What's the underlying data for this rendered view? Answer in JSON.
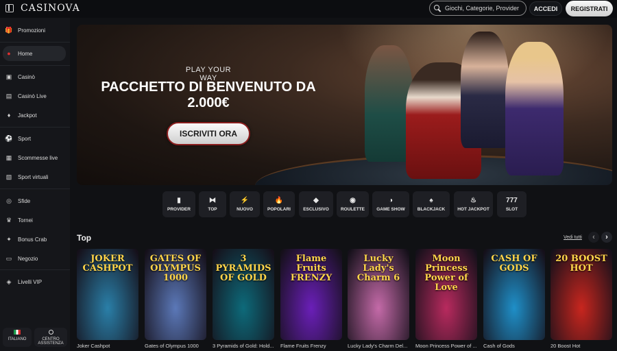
{
  "header": {
    "logo": "CASINOVA",
    "search_placeholder": "Giochi, Categorie, Provider",
    "login_label": "ACCEDI",
    "register_label": "REGISTRATI"
  },
  "sidebar": {
    "items": [
      {
        "label": "Promozioni",
        "icon": "gift-icon"
      },
      {
        "label": "Home",
        "icon": "home-icon"
      },
      {
        "label": "Casinò",
        "icon": "casino-icon"
      },
      {
        "label": "Casinò Live",
        "icon": "live-casino-icon"
      },
      {
        "label": "Jackpot",
        "icon": "jackpot-icon"
      },
      {
        "label": "Sport",
        "icon": "soccer-ball-icon"
      },
      {
        "label": "Scommesse live",
        "icon": "live-bet-icon"
      },
      {
        "label": "Sport virtuali",
        "icon": "virtual-sport-icon"
      },
      {
        "label": "Sfide",
        "icon": "challenge-icon"
      },
      {
        "label": "Tornei",
        "icon": "trophy-icon"
      },
      {
        "label": "Bonus Crab",
        "icon": "crab-icon"
      },
      {
        "label": "Negozio",
        "icon": "shop-icon"
      },
      {
        "label": "Livelli VIP",
        "icon": "vip-icon"
      }
    ],
    "language": "ITALIANO",
    "support": "CENTRO ASSISTENZA"
  },
  "banner": {
    "kicker": "PLAY YOUR WAY",
    "headline": "PACCHETTO DI BENVENUTO DA 2.000€",
    "cta": "ISCRIVITI ORA"
  },
  "categories": [
    {
      "label": "PROVIDER",
      "icon": "provider-icon"
    },
    {
      "label": "TOP",
      "icon": "top-icon"
    },
    {
      "label": "NUOVO",
      "icon": "new-icon"
    },
    {
      "label": "POPOLARI",
      "icon": "fire-icon"
    },
    {
      "label": "ESCLUSIVO",
      "icon": "diamond-icon"
    },
    {
      "label": "ROULETTE",
      "icon": "roulette-icon"
    },
    {
      "label": "GAME SHOW",
      "icon": "mask-icon"
    },
    {
      "label": "BLACKJACK",
      "icon": "cards-icon"
    },
    {
      "label": "HOT JACKPOT",
      "icon": "flame-icon"
    },
    {
      "label": "SLOT",
      "icon": "slot-icon"
    }
  ],
  "top": {
    "title": "Top",
    "see_all": "Vedi tutti",
    "games": [
      {
        "name": "Joker Cashpot",
        "art_title": "JOKER CASHPOT",
        "color": "#2a7fa8"
      },
      {
        "name": "Gates of Olympus 1000",
        "art_title": "GATES OF OLYMPUS 1000",
        "color": "#5b78b8"
      },
      {
        "name": "3 Pyramids of Gold: Hold...",
        "art_title": "3 PYRAMIDS OF GOLD",
        "color": "#0d6a7a"
      },
      {
        "name": "Flame Fruits Frenzy",
        "art_title": "Flame Fruits FRENZY",
        "color": "#6a1fb8"
      },
      {
        "name": "Lucky Lady's Charm Del...",
        "art_title": "Lucky Lady's Charm 6",
        "color": "#c46aa8"
      },
      {
        "name": "Moon Princess Power of ...",
        "art_title": "Moon Princess Power of Love",
        "color": "#b82a5e"
      },
      {
        "name": "Cash of Gods",
        "art_title": "CASH OF GODS",
        "color": "#1f8fc8"
      },
      {
        "name": "20 Boost Hot",
        "art_title": "20 BOOST HOT",
        "color": "#c8261e"
      }
    ]
  }
}
